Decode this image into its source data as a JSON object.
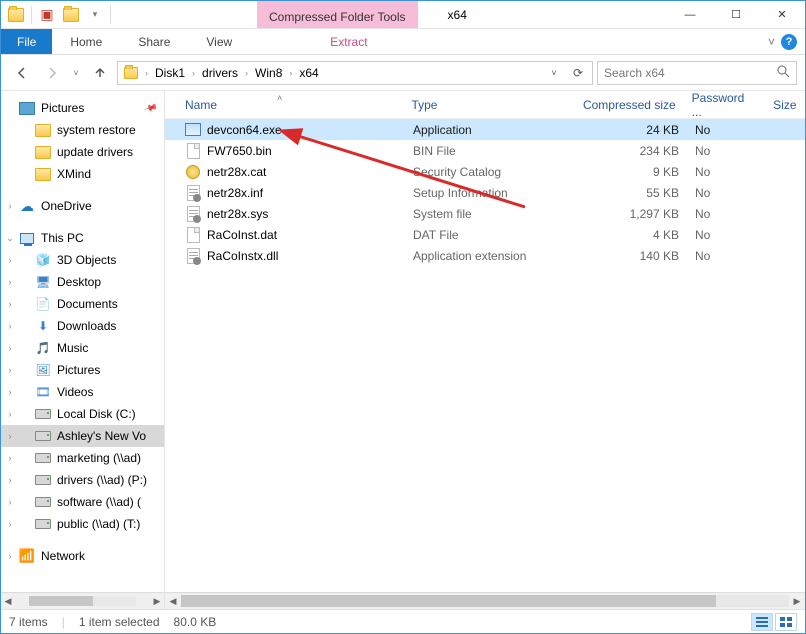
{
  "titlebar": {
    "context_tab": "Compressed Folder Tools",
    "title": "x64",
    "minimize": "—",
    "maximize": "☐",
    "close": "✕"
  },
  "ribbon": {
    "file": "File",
    "tabs": [
      "Home",
      "Share",
      "View"
    ],
    "extract": "Extract",
    "expand_tip": "˅",
    "help": "?"
  },
  "address": {
    "segments": [
      "Disk1",
      "drivers",
      "Win8",
      "x64"
    ],
    "refresh": "⟳",
    "search_placeholder": "Search x64"
  },
  "nav": {
    "pictures": "Pictures",
    "items_quick": [
      "system restore",
      "update drivers",
      "XMind"
    ],
    "onedrive": "OneDrive",
    "thispc": "This PC",
    "thispc_items": [
      {
        "label": "3D Objects",
        "icon": "cube"
      },
      {
        "label": "Desktop",
        "icon": "desktop"
      },
      {
        "label": "Documents",
        "icon": "doc"
      },
      {
        "label": "Downloads",
        "icon": "down"
      },
      {
        "label": "Music",
        "icon": "music"
      },
      {
        "label": "Pictures",
        "icon": "pics"
      },
      {
        "label": "Videos",
        "icon": "video"
      },
      {
        "label": "Local Disk (C:)",
        "icon": "drive"
      },
      {
        "label": "Ashley's New Vo",
        "icon": "drive"
      },
      {
        "label": "marketing (\\\\ad)",
        "icon": "netdrive"
      },
      {
        "label": "drivers (\\\\ad) (P:)",
        "icon": "netdrive"
      },
      {
        "label": "software (\\\\ad) (",
        "icon": "netdrive"
      },
      {
        "label": "public (\\\\ad) (T:)",
        "icon": "netdrive"
      }
    ],
    "network": "Network"
  },
  "columns": {
    "name": "Name",
    "type": "Type",
    "csize": "Compressed size",
    "pwd": "Password ...",
    "size": "Size"
  },
  "files": [
    {
      "name": "devcon64.exe",
      "type": "Application",
      "csize": "24 KB",
      "pwd": "No",
      "icon": "exe",
      "selected": true
    },
    {
      "name": "FW7650.bin",
      "type": "BIN File",
      "csize": "234 KB",
      "pwd": "No",
      "icon": "doc"
    },
    {
      "name": "netr28x.cat",
      "type": "Security Catalog",
      "csize": "9 KB",
      "pwd": "No",
      "icon": "cat"
    },
    {
      "name": "netr28x.inf",
      "type": "Setup Information",
      "csize": "55 KB",
      "pwd": "No",
      "icon": "inf"
    },
    {
      "name": "netr28x.sys",
      "type": "System file",
      "csize": "1,297 KB",
      "pwd": "No",
      "icon": "sys"
    },
    {
      "name": "RaCoInst.dat",
      "type": "DAT File",
      "csize": "4 KB",
      "pwd": "No",
      "icon": "doc"
    },
    {
      "name": "RaCoInstx.dll",
      "type": "Application extension",
      "csize": "140 KB",
      "pwd": "No",
      "icon": "dll"
    }
  ],
  "status": {
    "count": "7 items",
    "selected": "1 item selected",
    "size": "80.0 KB"
  }
}
